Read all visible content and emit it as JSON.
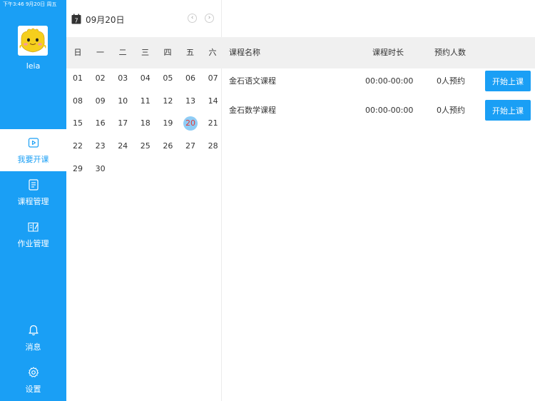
{
  "status_bar": {
    "text": "下午3:46   9月20日 周五"
  },
  "sidebar": {
    "username": "leia",
    "items": [
      {
        "label": "我要开课",
        "icon": "play-icon"
      },
      {
        "label": "课程管理",
        "icon": "document-icon"
      },
      {
        "label": "作业管理",
        "icon": "book-icon"
      },
      {
        "label": "消息",
        "icon": "bell-icon"
      },
      {
        "label": "设置",
        "icon": "gear-icon"
      }
    ],
    "active_index": 0,
    "colors": {
      "background": "#1a9ff5",
      "active_bg": "#ffffff"
    }
  },
  "calendar": {
    "title": "09月20日",
    "prev_label": "‹",
    "next_label": "›",
    "calendar_icon_digit": "7",
    "weekdays": [
      "日",
      "一",
      "二",
      "三",
      "四",
      "五",
      "六"
    ],
    "days": [
      "01",
      "02",
      "03",
      "04",
      "05",
      "06",
      "07",
      "08",
      "09",
      "10",
      "11",
      "12",
      "13",
      "14",
      "15",
      "16",
      "17",
      "18",
      "19",
      "20",
      "21",
      "22",
      "23",
      "24",
      "25",
      "26",
      "27",
      "28",
      "29",
      "30"
    ],
    "selected": "20",
    "selected_color": "#8fcdf6"
  },
  "course_table": {
    "headers": {
      "name": "课程名称",
      "duration": "课程时长",
      "reservations": "预约人数"
    },
    "rows": [
      {
        "name": "金石语文课程",
        "duration": "00:00-00:00",
        "reservations": "0人预约",
        "action": "开始上课"
      },
      {
        "name": "金石数学课程",
        "duration": "00:00-00:00",
        "reservations": "0人预约",
        "action": "开始上课"
      }
    ]
  }
}
